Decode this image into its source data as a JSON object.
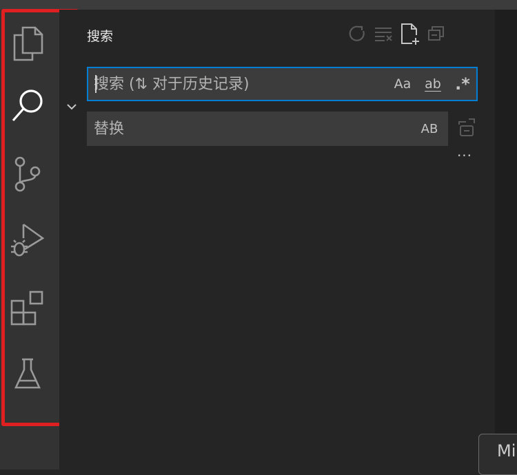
{
  "sidebar": {
    "title": "搜索"
  },
  "search": {
    "placeholder": "搜索 (⇅ 对于历史记录)",
    "match_case_label": "Aa",
    "whole_word_label": "ab",
    "regex_label": ".*"
  },
  "replace": {
    "placeholder": "替换",
    "preserve_case_label": "AB"
  },
  "more_label": "···",
  "bottom_button": {
    "label": "Mi"
  },
  "activity_bar": {
    "items": [
      {
        "name": "explorer-icon"
      },
      {
        "name": "search-icon",
        "active": true
      },
      {
        "name": "source-control-icon"
      },
      {
        "name": "run-debug-icon"
      },
      {
        "name": "extensions-icon"
      },
      {
        "name": "testing-icon"
      }
    ]
  },
  "colors": {
    "activity_bar_bg": "#333333",
    "sidebar_bg": "#252526",
    "input_bg": "#3c3c3c",
    "focus_border": "#007fd4",
    "highlight_border": "#e02020"
  }
}
